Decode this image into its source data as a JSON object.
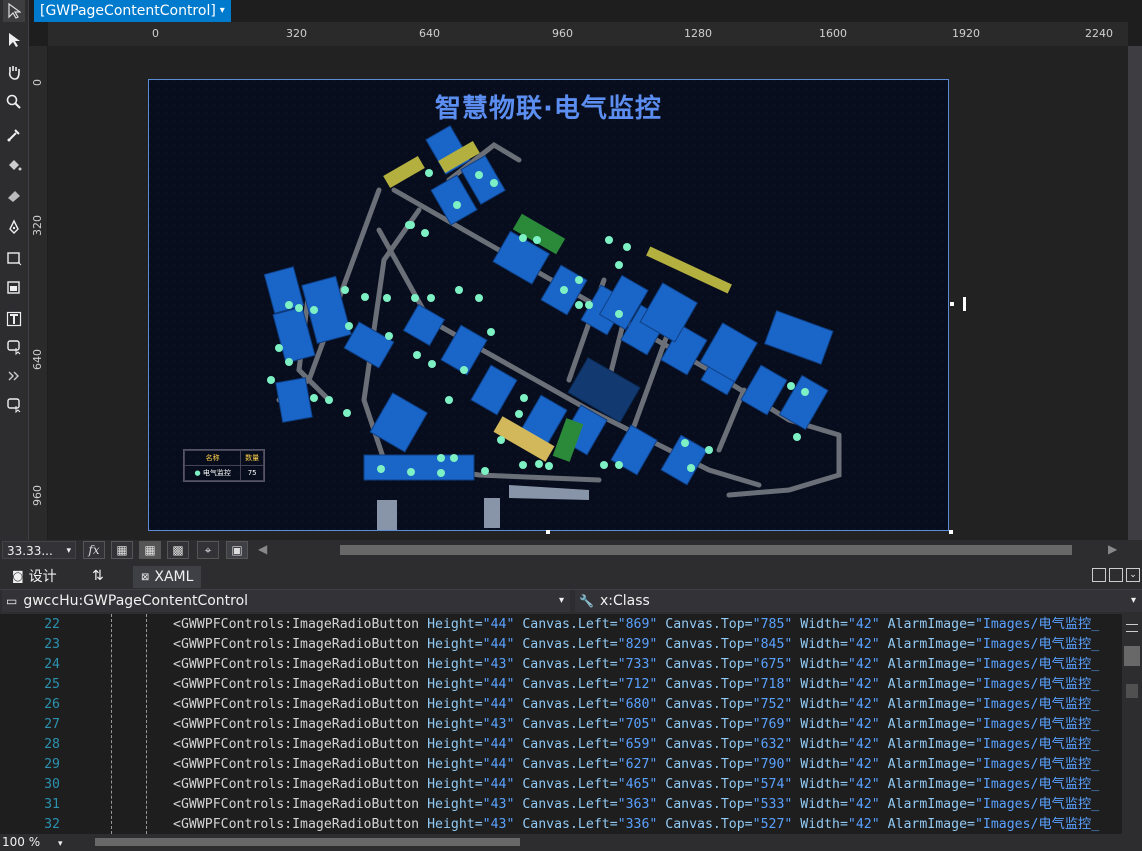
{
  "designer_tab": {
    "label": "[GWPageContentControl]"
  },
  "ruler_top": [
    "0",
    "320",
    "640",
    "960",
    "1280",
    "1600",
    "1920",
    "2240"
  ],
  "ruler_left": [
    "0",
    "320",
    "640",
    "960"
  ],
  "map": {
    "title": "智慧物联·电气监控",
    "legend": {
      "header_name": "名称",
      "header_count": "数量",
      "row_name": "电气监控",
      "row_count": "75"
    }
  },
  "zoom_bar": {
    "zoom_value": "33.33..."
  },
  "view_tabs": {
    "design": "设计",
    "xaml": "XAML"
  },
  "nav": {
    "left": "gwccHu:GWPageContentControl",
    "right": "x:Class"
  },
  "code_lines": [
    {
      "no": "22",
      "left": "869",
      "top": "785",
      "height": "44"
    },
    {
      "no": "23",
      "left": "829",
      "top": "845",
      "height": "44"
    },
    {
      "no": "24",
      "left": "733",
      "top": "675",
      "height": "43"
    },
    {
      "no": "25",
      "left": "712",
      "top": "718",
      "height": "44"
    },
    {
      "no": "26",
      "left": "680",
      "top": "752",
      "height": "44"
    },
    {
      "no": "27",
      "left": "705",
      "top": "769",
      "height": "43"
    },
    {
      "no": "28",
      "left": "659",
      "top": "632",
      "height": "44"
    },
    {
      "no": "29",
      "left": "627",
      "top": "790",
      "height": "44"
    },
    {
      "no": "30",
      "left": "465",
      "top": "574",
      "height": "44"
    },
    {
      "no": "31",
      "left": "363",
      "top": "533",
      "height": "43"
    },
    {
      "no": "32",
      "left": "336",
      "top": "527",
      "height": "43"
    }
  ],
  "code_text": {
    "tag": "<GWWPFControls:ImageRadioButton",
    "attr_height": "Height=",
    "attr_left": "Canvas.Left=",
    "attr_top": "Canvas.Top=",
    "attr_width": "Width=",
    "width_value": "\"42\"",
    "attr_alarm": "AlarmImage=",
    "alarm_value": "\"Images/电气监控_"
  },
  "status": {
    "zoom": "100 %"
  }
}
